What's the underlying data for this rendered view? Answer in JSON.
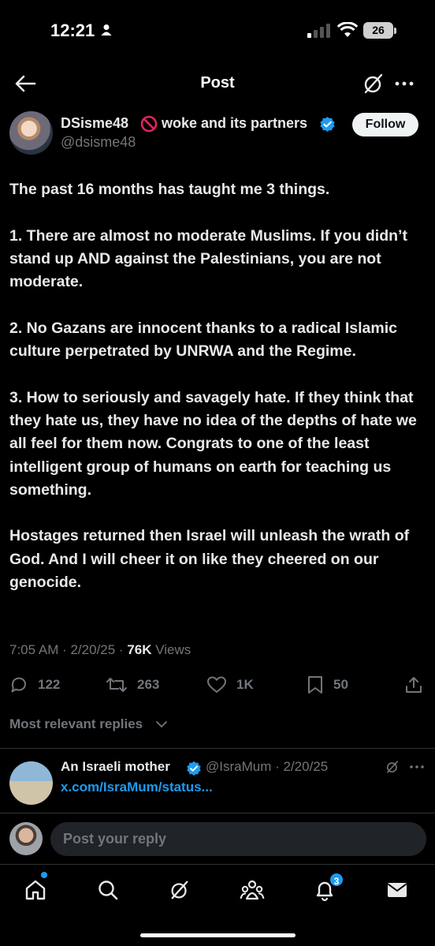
{
  "status_bar": {
    "time": "12:21",
    "battery": "26"
  },
  "header": {
    "title": "Post"
  },
  "author": {
    "name_part1": "DSisme48",
    "name_part2": "woke and its partners",
    "handle": "@dsisme48",
    "follow_label": "Follow"
  },
  "post": {
    "paragraphs": [
      "The past 16 months has taught me 3 things.",
      "1. There are almost no moderate Muslims. If you didn’t stand up AND against the Palestinians, you are not moderate.",
      "2. No Gazans are innocent thanks to a radical Islamic culture perpetrated by UNRWA and the Regime.",
      "3. How to seriously and savagely hate. If they think that they hate us, they have no idea of the depths of hate we all feel for them now. Congrats to one of the least intelligent group of humans on earth for teaching us something.",
      "Hostages returned then Israel will unleash the wrath of God. And I will cheer it on like they cheered on our genocide."
    ],
    "timestamp": "7:05 AM · 2/20/25 · ",
    "views_count": "76K",
    "views_label": " Views"
  },
  "actions": {
    "replies": "122",
    "reposts": "263",
    "likes": "1K",
    "bookmarks": "50"
  },
  "replies_filter": {
    "label": "Most relevant replies"
  },
  "reply": {
    "name": "An Israeli mother",
    "handle_date": "@IsraMum · 2/20/25",
    "link": "x.com/IsraMum/status..."
  },
  "composer": {
    "placeholder": "Post your reply"
  },
  "tabbar": {
    "notifications_badge": "3"
  },
  "colors": {
    "accent": "#1d9bf0",
    "muted": "#71767b",
    "text": "#e7e9ea",
    "background": "#000000"
  },
  "icons": [
    "back-arrow-icon",
    "grok-icon",
    "more-icon",
    "verified-icon",
    "reply-icon",
    "repost-icon",
    "like-icon",
    "bookmark-icon",
    "share-icon",
    "home-icon",
    "search-icon",
    "communities-icon",
    "bell-icon",
    "mail-icon"
  ]
}
